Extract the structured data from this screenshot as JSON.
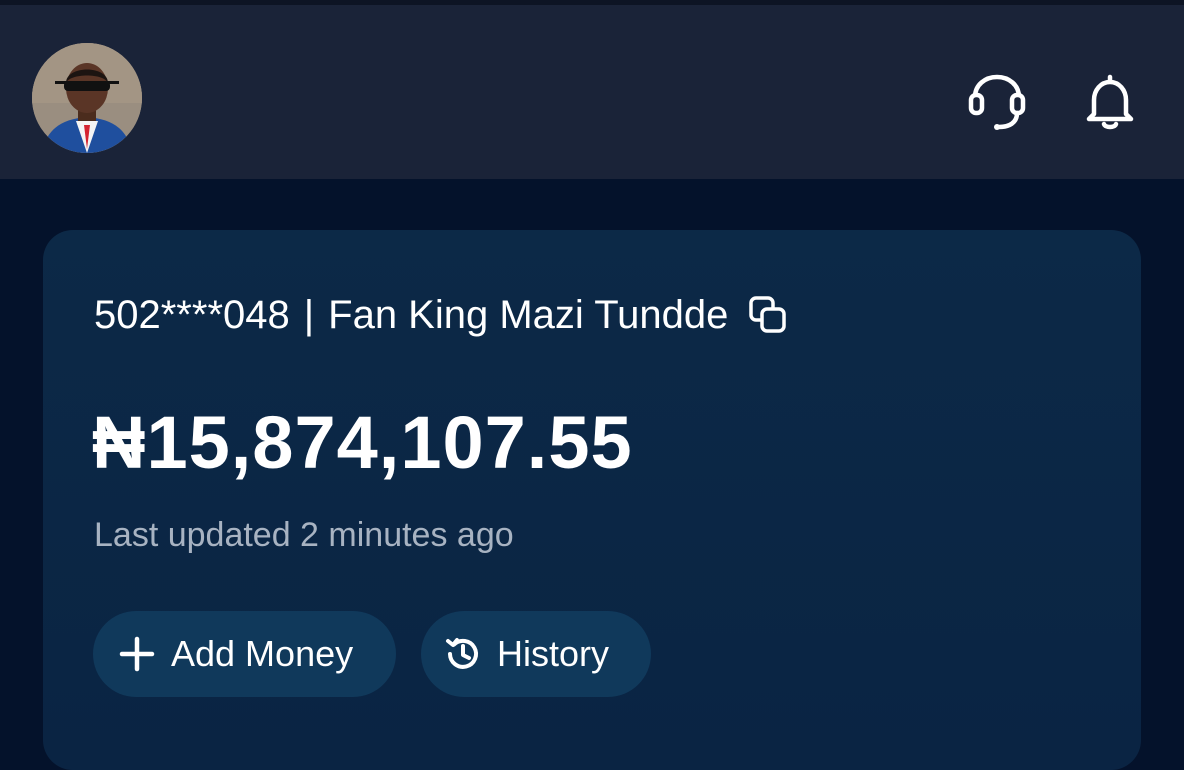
{
  "header": {
    "avatar_alt": "profile photo",
    "support_icon": "headset-icon",
    "notification_icon": "bell-icon"
  },
  "account": {
    "masked_number": "502****048",
    "separator": "|",
    "name": "Fan King Mazi Tundde",
    "copy_icon": "copy-icon"
  },
  "wallet": {
    "balance": "₦15,874,107.55",
    "last_updated": "Last updated 2 minutes ago"
  },
  "actions": {
    "add_money_label": "Add Money",
    "history_label": "History"
  },
  "colors": {
    "header_bg": "#1a2338",
    "page_bg": "#04122b",
    "card_bg": "#0c2947",
    "pill_bg": "#10395b",
    "muted_text": "#a8b3c2"
  }
}
